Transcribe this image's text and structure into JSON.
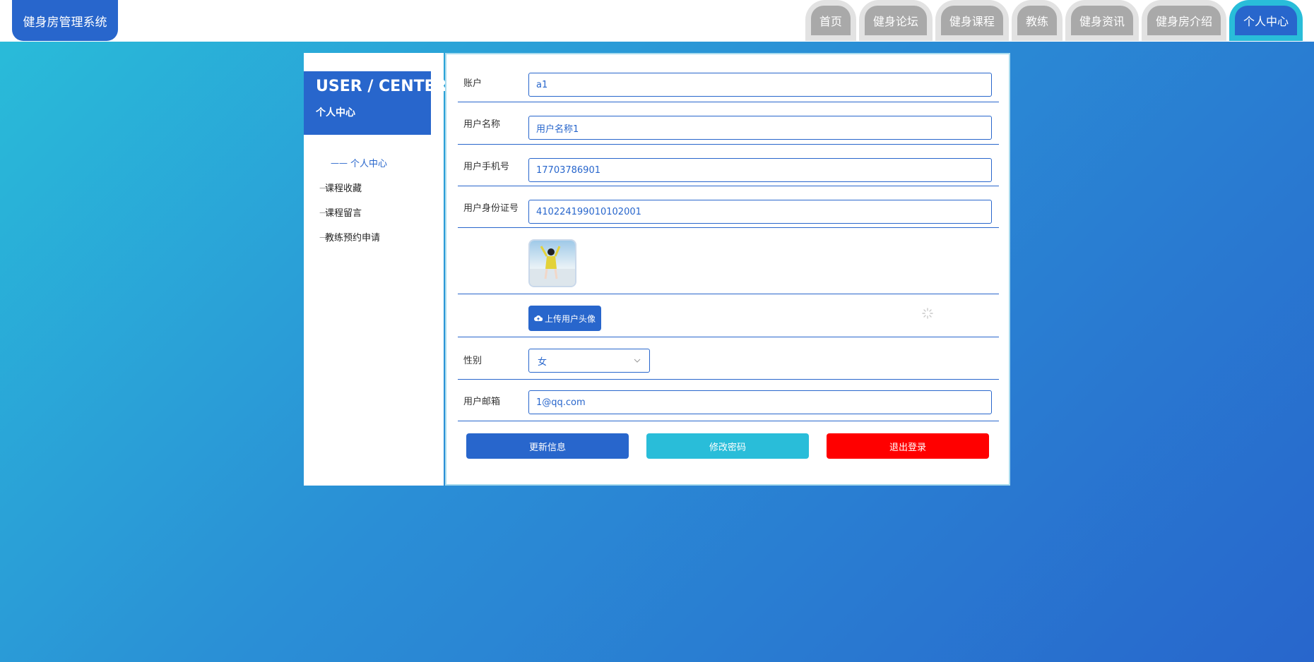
{
  "header": {
    "brand": "健身房管理系统",
    "nav": [
      "首页",
      "健身论坛",
      "健身课程",
      "教练",
      "健身资讯",
      "健身房介绍",
      "个人中心"
    ],
    "active_nav": "个人中心"
  },
  "sidebar": {
    "title_en": "USER / CENTER",
    "title_zh": "个人中心",
    "active_prefix": "——",
    "dash": "—",
    "items": [
      "个人中心",
      "课程收藏",
      "课程留言",
      "教练预约申请"
    ]
  },
  "form": {
    "account_label": "账户",
    "account_value": "a1",
    "username_label": "用户名称",
    "username_value": "用户名称1",
    "phone_label": "用户手机号",
    "phone_value": "17703786901",
    "idcard_label": "用户身份证号",
    "idcard_value": "410224199010102001",
    "upload_label": "上传用户头像",
    "gender_label": "性别",
    "gender_value": "女",
    "email_label": "用户邮箱",
    "email_value": "1@qq.com"
  },
  "buttons": {
    "update": "更新信息",
    "change_password": "修改密码",
    "logout": "退出登录"
  },
  "icons": {
    "upload": "cloud-upload-icon",
    "select_arrow": "chevron-down-icon",
    "loading": "loading-spinner-icon"
  },
  "colors": {
    "primary": "#2866cc",
    "accent": "#29bdd9",
    "danger": "#ff0000",
    "nav_inactive": "#a9a9a9"
  }
}
